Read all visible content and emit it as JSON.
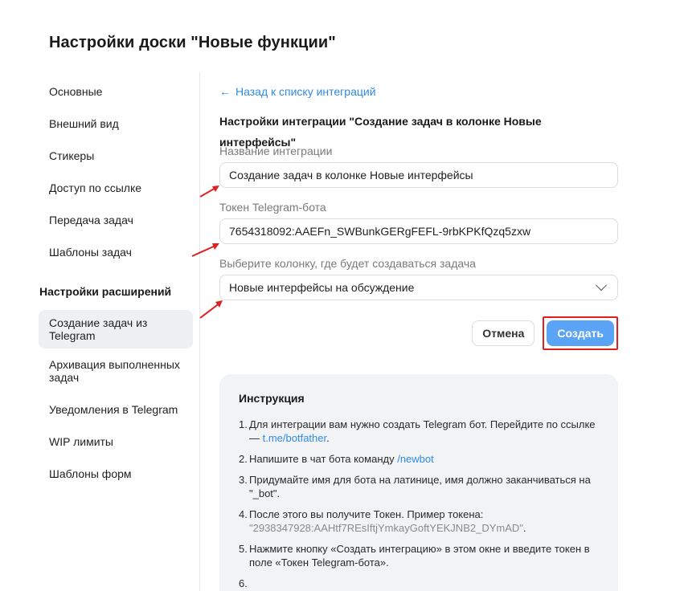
{
  "page_title": "Настройки доски \"Новые функции\"",
  "sidebar": {
    "items": [
      {
        "label": "Основные"
      },
      {
        "label": "Внешний вид"
      },
      {
        "label": "Стикеры"
      },
      {
        "label": "Доступ по ссылке"
      },
      {
        "label": "Передача задач"
      },
      {
        "label": "Шаблоны задач"
      }
    ],
    "section_title": "Настройки расширений",
    "ext_items": [
      {
        "label": "Создание задач из Telegram"
      },
      {
        "label": "Архивация выполненных задач"
      },
      {
        "label": "Уведомления в Telegram"
      },
      {
        "label": "WIP лимиты"
      },
      {
        "label": "Шаблоны форм"
      }
    ]
  },
  "main": {
    "back_link": "Назад к списку интеграций",
    "section_title": "Настройки интеграции \"Создание задач в колонке Новые интерфейсы\"",
    "fields": {
      "name_label": "Название интеграции",
      "name_value": "Создание задач в колонке Новые интерфейсы",
      "token_label": "Токен Telegram-бота",
      "token_value": "7654318092:AAEFn_SWBunkGERgFEFL-9rbKPKfQzq5zxw",
      "column_label": "Выберите колонку, где будет создаваться задача",
      "column_value": "Новые интерфейсы на обсуждение"
    },
    "buttons": {
      "cancel": "Отмена",
      "create": "Создать"
    }
  },
  "instruction": {
    "title": "Инструкция",
    "steps": [
      {
        "num": "1.",
        "a": "Для интеграции вам нужно создать Telegram бот. Перейдите по ссылке — ",
        "link": "t.me/botfather",
        "b": "."
      },
      {
        "num": "2.",
        "a": "Напишите в чат бота команду ",
        "link": "/newbot",
        "b": ""
      },
      {
        "num": "3.",
        "a": "Придумайте имя для бота на латинице, имя должно заканчиваться на \"_bot\".",
        "link": "",
        "b": ""
      },
      {
        "num": "4.",
        "a": "После этого вы получите Токен. Пример токена: ",
        "muted": "\"2938347928:AAHtf7REsIftjYmkayGoftYEKJNB2_DYmAD\"",
        "b": "."
      },
      {
        "num": "5.",
        "a": "Нажмите кнопку «Создать интеграцию» в этом окне и введите токен в поле «Токен Telegram-бота».",
        "link": "",
        "b": ""
      },
      {
        "num": "6.",
        "a": "",
        "link": "",
        "b": ""
      }
    ]
  },
  "colors": {
    "accent": "#2f8be6",
    "create_button": "#5aa3f5",
    "annotation_red": "#e02020",
    "active_bg": "#eef0f3",
    "instruction_bg": "#f1f3f5"
  },
  "icons": {
    "back": "arrow-left-icon",
    "select": "chevron-down-icon"
  }
}
